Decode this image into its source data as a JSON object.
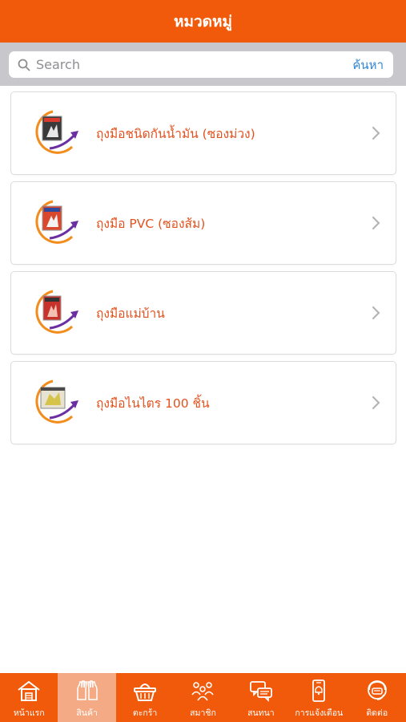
{
  "header": {
    "title": "หมวดหมู่"
  },
  "search": {
    "placeholder": "Search",
    "value": "",
    "button_label": "ค้นหา"
  },
  "categories": [
    {
      "label": "ถุงมือชนิดกันน้ำมัน (ซองม่วง)",
      "icon": "glove-package-icon"
    },
    {
      "label": "ถุงมือ PVC (ซองส้ม)",
      "icon": "glove-package-icon"
    },
    {
      "label": "ถุงมือแม่บ้าน",
      "icon": "glove-package-icon"
    },
    {
      "label": "ถุงมือไนไตร 100 ชิ้น",
      "icon": "glove-package-icon"
    }
  ],
  "tabbar": {
    "active_index": 1,
    "items": [
      {
        "label": "หน้าแรก",
        "icon": "home-icon"
      },
      {
        "label": "สินค้า",
        "icon": "gloves-icon"
      },
      {
        "label": "ตะกร้า",
        "icon": "basket-icon"
      },
      {
        "label": "สมาชิก",
        "icon": "members-icon"
      },
      {
        "label": "สนทนา",
        "icon": "chat-icon"
      },
      {
        "label": "การแจ้งเตือน",
        "icon": "phone-notification-icon"
      },
      {
        "label": "ติดต่อ",
        "icon": "support-icon"
      }
    ]
  },
  "colors": {
    "brand": "#f15a0a",
    "tab_active": "#f4ab85",
    "link": "#2f86d6",
    "item_text": "#e2521f"
  }
}
